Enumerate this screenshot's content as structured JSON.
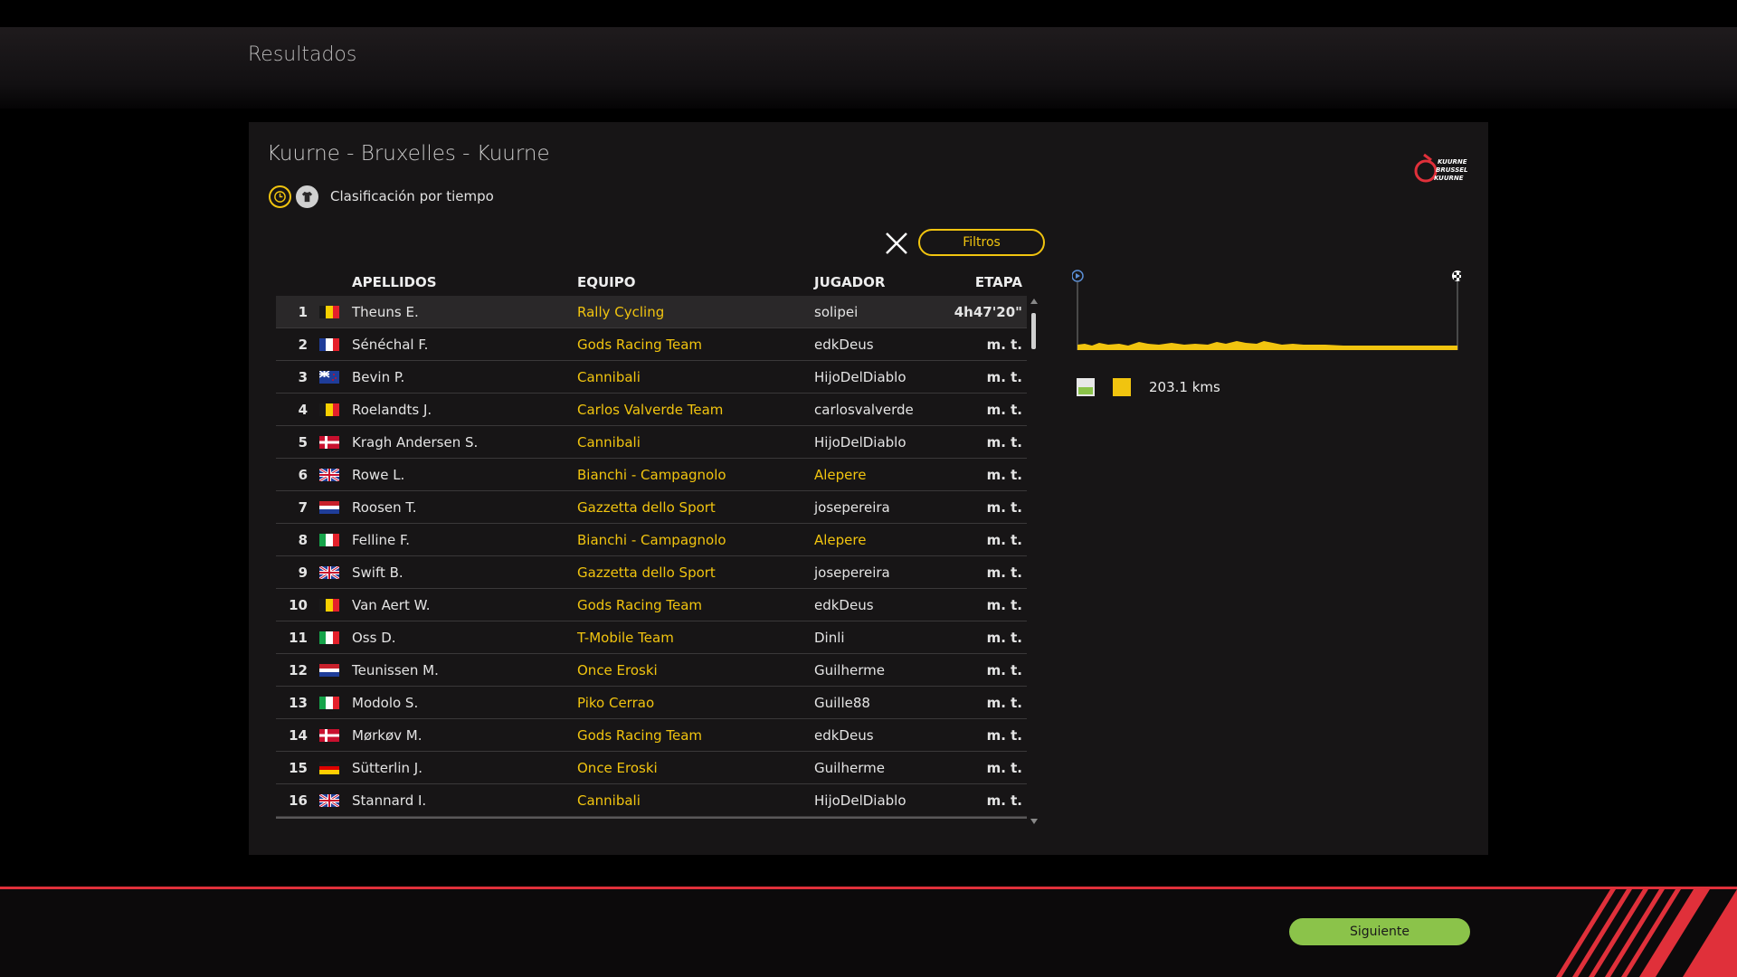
{
  "header": {
    "title": "Resultados"
  },
  "race": {
    "name": "Kuurne - Bruxelles - Kuurne",
    "logo_text": [
      "KUURNE",
      "BRUSSEL",
      "KUURNE"
    ]
  },
  "classification": {
    "label": "Clasificación por tiempo"
  },
  "filters": {
    "label": "Filtros"
  },
  "table": {
    "headers": {
      "name": "APELLIDOS",
      "team": "EQUIPO",
      "player": "JUGADOR",
      "stage": "ETAPA"
    },
    "rows": [
      {
        "pos": "1",
        "flag": "BEL",
        "name": "Theuns E.",
        "team": "Rally Cycling",
        "player": "solipei",
        "time": "4h47'20\""
      },
      {
        "pos": "2",
        "flag": "FRA",
        "name": "Sénéchal F.",
        "team": "Gods Racing Team",
        "player": "edkDeus",
        "time": "m. t."
      },
      {
        "pos": "3",
        "flag": "NZL",
        "name": "Bevin P.",
        "team": "Cannibali",
        "player": "HijoDelDiablo",
        "time": "m. t."
      },
      {
        "pos": "4",
        "flag": "BEL",
        "name": "Roelandts J.",
        "team": "Carlos Valverde Team",
        "player": "carlosvalverde",
        "time": "m. t."
      },
      {
        "pos": "5",
        "flag": "DEN",
        "name": "Kragh Andersen S.",
        "team": "Cannibali",
        "player": "HijoDelDiablo",
        "time": "m. t."
      },
      {
        "pos": "6",
        "flag": "GBR",
        "name": "Rowe L.",
        "team": "Bianchi - Campagnolo",
        "player": "Alepere",
        "time": "m. t."
      },
      {
        "pos": "7",
        "flag": "NED",
        "name": "Roosen T.",
        "team": "Gazzetta dello Sport",
        "player": "josepereira",
        "time": "m. t."
      },
      {
        "pos": "8",
        "flag": "ITA",
        "name": "Felline F.",
        "team": "Bianchi - Campagnolo",
        "player": "Alepere",
        "time": "m. t."
      },
      {
        "pos": "9",
        "flag": "GBR",
        "name": "Swift B.",
        "team": "Gazzetta dello Sport",
        "player": "josepereira",
        "time": "m. t."
      },
      {
        "pos": "10",
        "flag": "BEL",
        "name": "Van Aert W.",
        "team": "Gods Racing Team",
        "player": "edkDeus",
        "time": "m. t."
      },
      {
        "pos": "11",
        "flag": "ITA",
        "name": "Oss D.",
        "team": "T-Mobile Team",
        "player": "Dinli",
        "time": "m. t."
      },
      {
        "pos": "12",
        "flag": "NED",
        "name": "Teunissen M.",
        "team": "Once Eroski",
        "player": "Guilherme",
        "time": "m. t."
      },
      {
        "pos": "13",
        "flag": "ITA",
        "name": "Modolo S.",
        "team": "Piko Cerrao",
        "player": "Guille88",
        "time": "m. t."
      },
      {
        "pos": "14",
        "flag": "DEN",
        "name": "Mørkøv M.",
        "team": "Gods Racing Team",
        "player": "edkDeus",
        "time": "m. t."
      },
      {
        "pos": "15",
        "flag": "GER",
        "name": "Sütterlin J.",
        "team": "Once Eroski",
        "player": "Guilherme",
        "time": "m. t."
      },
      {
        "pos": "16",
        "flag": "GBR",
        "name": "Stannard I.",
        "team": "Cannibali",
        "player": "HijoDelDiablo",
        "time": "m. t."
      }
    ],
    "highlight_player": "Alepere"
  },
  "profile": {
    "distance": "203.1 kms",
    "colors": {
      "profile": "#f1c40f",
      "grass": "#8bc34a"
    }
  },
  "footer": {
    "next_label": "Siguiente"
  },
  "colors": {
    "accent": "#f1c40f",
    "next": "#8bc34a",
    "red": "#e0303a"
  }
}
